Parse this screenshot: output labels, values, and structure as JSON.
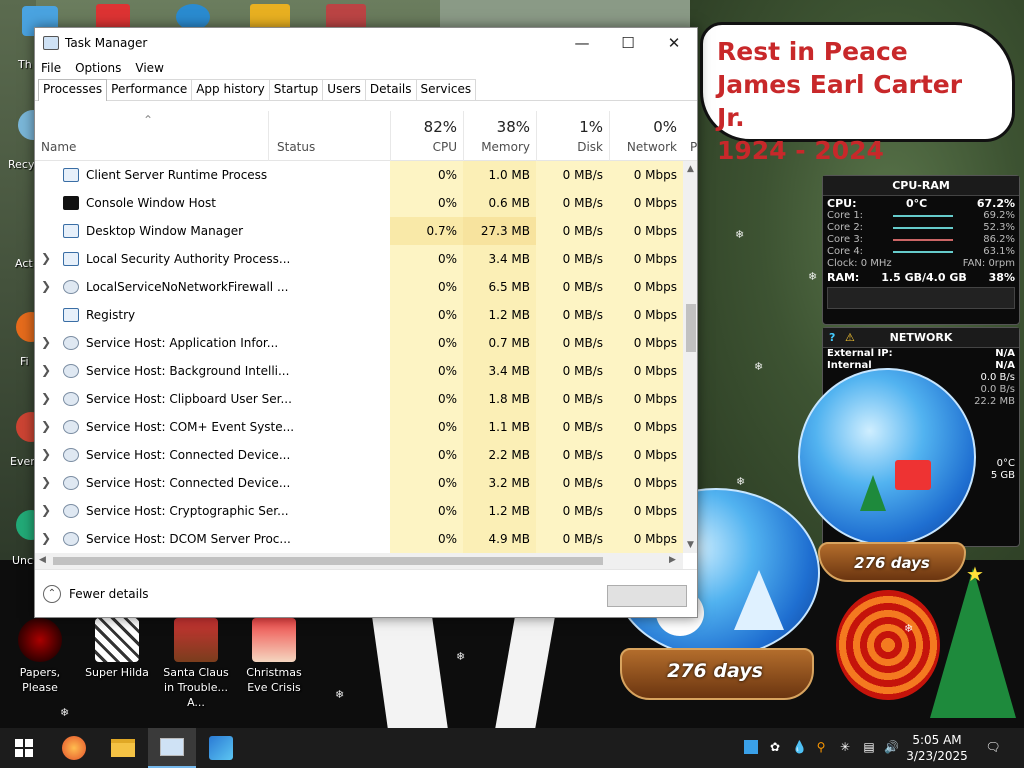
{
  "window": {
    "title": "Task Manager",
    "menu": [
      "File",
      "Options",
      "View"
    ],
    "tabs": [
      "Processes",
      "Performance",
      "App history",
      "Startup",
      "Users",
      "Details",
      "Services"
    ],
    "active_tab": "Processes"
  },
  "columns": {
    "name": "Name",
    "status": "Status",
    "cpu": {
      "pct": "82%",
      "label": "CPU"
    },
    "memory": {
      "pct": "38%",
      "label": "Memory"
    },
    "disk": {
      "pct": "1%",
      "label": "Disk"
    },
    "network": {
      "pct": "0%",
      "label": "Network"
    },
    "truncated": "P"
  },
  "processes": [
    {
      "name": "Client Server Runtime Process",
      "cpu": "0%",
      "memory": "1.0 MB",
      "disk": "0 MB/s",
      "network": "0 Mbps",
      "expand": false,
      "icon": "window-icon"
    },
    {
      "name": "Console Window Host",
      "cpu": "0%",
      "memory": "0.6 MB",
      "disk": "0 MB/s",
      "network": "0 Mbps",
      "expand": false,
      "icon": "console-icon"
    },
    {
      "name": "Desktop Window Manager",
      "cpu": "0.7%",
      "memory": "27.3 MB",
      "disk": "0 MB/s",
      "network": "0 Mbps",
      "expand": false,
      "icon": "window-icon"
    },
    {
      "name": "Local Security Authority Process...",
      "cpu": "0%",
      "memory": "3.4 MB",
      "disk": "0 MB/s",
      "network": "0 Mbps",
      "expand": true,
      "icon": "window-icon"
    },
    {
      "name": "LocalServiceNoNetworkFirewall ...",
      "cpu": "0%",
      "memory": "6.5 MB",
      "disk": "0 MB/s",
      "network": "0 Mbps",
      "expand": true,
      "icon": "gear-icon"
    },
    {
      "name": "Registry",
      "cpu": "0%",
      "memory": "1.2 MB",
      "disk": "0 MB/s",
      "network": "0 Mbps",
      "expand": false,
      "icon": "window-icon"
    },
    {
      "name": "Service Host: Application Infor...",
      "cpu": "0%",
      "memory": "0.7 MB",
      "disk": "0 MB/s",
      "network": "0 Mbps",
      "expand": true,
      "icon": "gear-icon"
    },
    {
      "name": "Service Host: Background Intelli...",
      "cpu": "0%",
      "memory": "3.4 MB",
      "disk": "0 MB/s",
      "network": "0 Mbps",
      "expand": true,
      "icon": "gear-icon"
    },
    {
      "name": "Service Host: Clipboard User Ser...",
      "cpu": "0%",
      "memory": "1.8 MB",
      "disk": "0 MB/s",
      "network": "0 Mbps",
      "expand": true,
      "icon": "gear-icon"
    },
    {
      "name": "Service Host: COM+ Event Syste...",
      "cpu": "0%",
      "memory": "1.1 MB",
      "disk": "0 MB/s",
      "network": "0 Mbps",
      "expand": true,
      "icon": "gear-icon"
    },
    {
      "name": "Service Host: Connected Device...",
      "cpu": "0%",
      "memory": "2.2 MB",
      "disk": "0 MB/s",
      "network": "0 Mbps",
      "expand": true,
      "icon": "gear-icon"
    },
    {
      "name": "Service Host: Connected Device...",
      "cpu": "0%",
      "memory": "3.2 MB",
      "disk": "0 MB/s",
      "network": "0 Mbps",
      "expand": true,
      "icon": "gear-icon"
    },
    {
      "name": "Service Host: Cryptographic Ser...",
      "cpu": "0%",
      "memory": "1.2 MB",
      "disk": "0 MB/s",
      "network": "0 Mbps",
      "expand": true,
      "icon": "gear-icon"
    },
    {
      "name": "Service Host: DCOM Server Proc...",
      "cpu": "0%",
      "memory": "4.9 MB",
      "disk": "0 MB/s",
      "network": "0 Mbps",
      "expand": true,
      "icon": "gear-icon"
    }
  ],
  "footer": {
    "fewer_details": "Fewer details"
  },
  "rip": [
    "Rest in Peace",
    "James Earl Carter Jr.",
    "1924 - 2024"
  ],
  "cpu_gadget": {
    "title": "CPU-RAM",
    "cpu_label": "CPU:",
    "temp": "0°C",
    "cpu_value": "67.2%",
    "cores": [
      {
        "label": "Core 1:",
        "value": "69.2%"
      },
      {
        "label": "Core 2:",
        "value": "52.3%"
      },
      {
        "label": "Core 3:",
        "value": "86.2%"
      },
      {
        "label": "Core 4:",
        "value": "63.1%"
      }
    ],
    "clock": "Clock: 0 MHz",
    "fan": "FAN: 0rpm",
    "ram_label": "RAM:",
    "ram_value": "1.5 GB/4.0 GB",
    "ram_pct": "38%"
  },
  "net_gadget": {
    "title": "NETWORK",
    "external_label": "External IP:",
    "external_value": "N/A",
    "internal_label": "Internal",
    "internal_value": "N/A",
    "rows": [
      "0.0 B/s",
      "0.0 B/s",
      "22.2 MB"
    ],
    "temp": "0°C",
    "size": "5 GB"
  },
  "globes": {
    "days": "276 days"
  },
  "desktop_icons": [
    {
      "label": "Papers, Please"
    },
    {
      "label": "Super Hilda"
    },
    {
      "label": "Santa Claus in Trouble... A..."
    },
    {
      "label": "Christmas Eve Crisis"
    }
  ],
  "left_fragments": [
    "Th",
    "Recy",
    "Act",
    "Fi",
    "Ever",
    "Unc"
  ],
  "clock": {
    "time": "5:05 AM",
    "date": "3/23/2025"
  },
  "colors": {
    "rip_text": "#c8282a",
    "cpu_col": "#fdf4c4",
    "mem_col": "#fbefb6",
    "taskbar": "#1c1c1c"
  }
}
